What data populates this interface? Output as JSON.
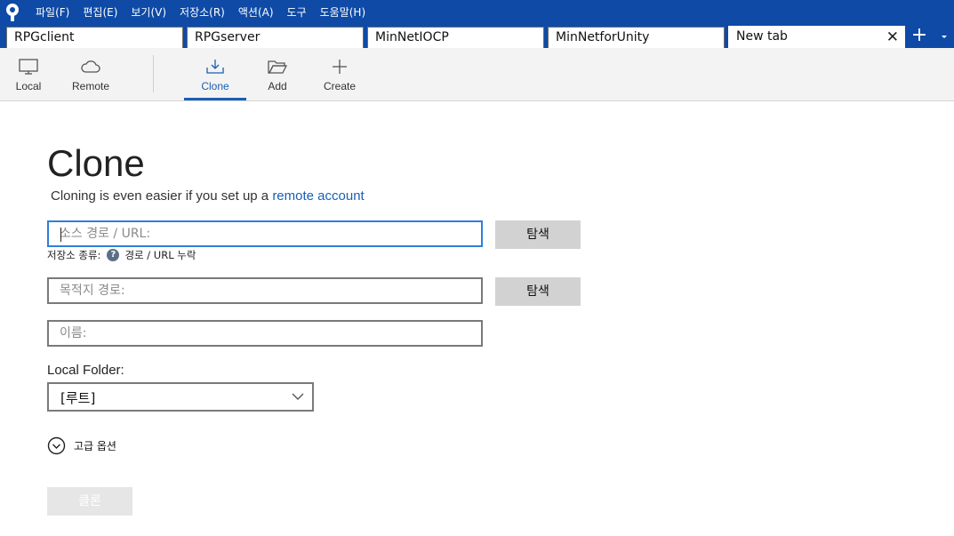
{
  "menubar": {
    "items": [
      "파일(F)",
      "편집(E)",
      "보기(V)",
      "저장소(R)",
      "액션(A)",
      "도구",
      "도움말(H)"
    ]
  },
  "tabs": [
    {
      "label": "RPGclient"
    },
    {
      "label": "RPGserver"
    },
    {
      "label": "MinNetIOCP"
    },
    {
      "label": "MinNetforUnity"
    },
    {
      "label": "New tab",
      "active": true
    }
  ],
  "tab_actions": {
    "add": "+"
  },
  "toolbar": {
    "local": "Local",
    "remote": "Remote",
    "clone": "Clone",
    "add": "Add",
    "create": "Create",
    "active": "Clone"
  },
  "form": {
    "title": "Clone",
    "subtitle_text": "Cloning is even easier if you set up a ",
    "subtitle_link": "remote account",
    "source_placeholder": "소스 경로 / URL:",
    "browse_label": "탐색",
    "repo_type_label": "저장소 종류:",
    "repo_type_help": "?",
    "repo_type_value": "경로 / URL 누락",
    "dest_placeholder": "목적지 경로:",
    "browse_label_2": "탐색",
    "name_placeholder": "이름:",
    "local_folder_label": "Local Folder:",
    "local_folder_value": "[루트]",
    "advanced_label": "고급 옵션",
    "clone_button": "클론"
  },
  "colors": {
    "menubar": "#0e4aa6",
    "accent": "#1a5fb4",
    "focus_border": "#2f7fd8",
    "toolbar_bg": "#f3f3f3"
  }
}
